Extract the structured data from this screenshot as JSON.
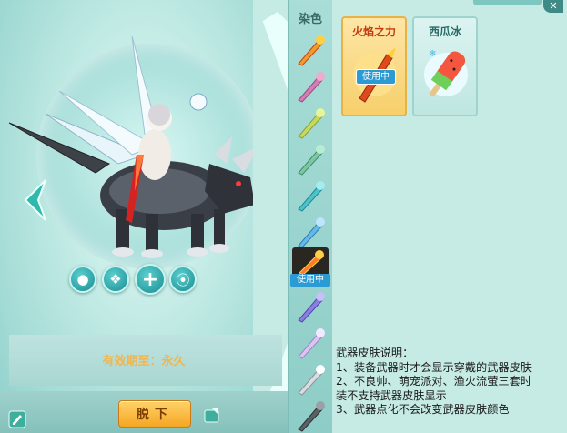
{
  "dye": {
    "title": "染色",
    "in_use_tag": "使用中"
  },
  "skins": [
    {
      "name": "火焰之力",
      "in_use": "使用中",
      "icon": "flame-weapon-icon"
    },
    {
      "name": "西瓜冰",
      "icon": "watermelon-popsicle-icon"
    }
  ],
  "preview": {
    "validity_label": "有效期至：",
    "validity_value": "永久",
    "unequip_label": "脱下"
  },
  "description": {
    "title": "武器皮肤说明：",
    "lines": [
      "1、装备武器时才会显示穿戴的武器皮肤",
      "2、不良帅、萌宠派对、渔火流萤三套时",
      "装不支持武器皮肤显示",
      "3、武器点化不会改变武器皮肤颜色"
    ]
  },
  "colors": {
    "accent_gold": "#f5a623",
    "in_use_blue": "#2c9bd3",
    "validity_orange": "#e8a23a"
  }
}
